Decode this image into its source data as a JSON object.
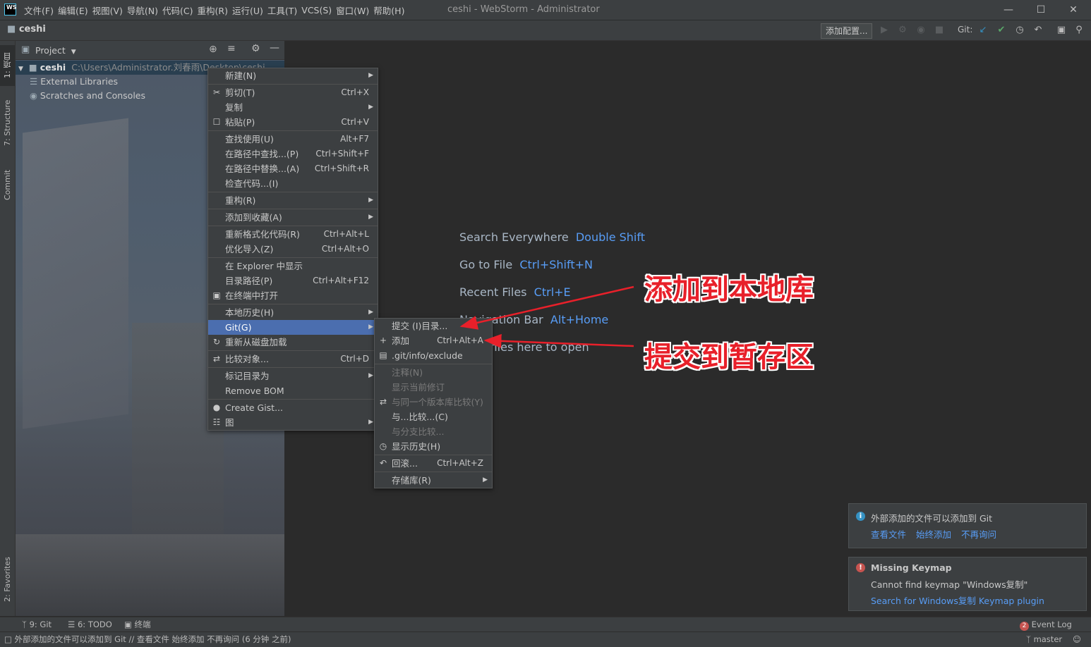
{
  "app": {
    "window_title": "ceshi - WebStorm - Administrator",
    "logo_text": "WS",
    "menubar": [
      "文件(F)",
      "编辑(E)",
      "视图(V)",
      "导航(N)",
      "代码(C)",
      "重构(R)",
      "运行(U)",
      "工具(T)",
      "VCS(S)",
      "窗口(W)",
      "帮助(H)"
    ]
  },
  "navbar": {
    "project": "ceshi",
    "add_config": "添加配置...",
    "git_label": "Git:"
  },
  "left_stripe": {
    "tabs": [
      "1: 项目",
      "7: Structure",
      "Commit",
      "2: Favorites"
    ]
  },
  "project_panel": {
    "title": "Project",
    "tree": [
      {
        "name": "ceshi",
        "path": "C:\\Users\\Administrator.刘春雨\\Desktop\\ceshi",
        "icon": "folder-icon"
      },
      {
        "name": "External Libraries",
        "icon": "library-icon"
      },
      {
        "name": "Scratches and Consoles",
        "icon": "scratch-icon"
      }
    ]
  },
  "editor_hints": [
    {
      "label": "Search Everywhere",
      "key": "Double Shift"
    },
    {
      "label": "Go to File",
      "key": "Ctrl+Shift+N"
    },
    {
      "label": "Recent Files",
      "key": "Ctrl+E"
    },
    {
      "label": "Navigation Bar",
      "key": "Alt+Home"
    },
    {
      "label": "Drop files here to open",
      "key": ""
    }
  ],
  "context_menu": [
    {
      "label": "新建(N)",
      "submenu": true
    },
    {
      "sep": true
    },
    {
      "label": "剪切(T)",
      "shortcut": "Ctrl+X",
      "icon": "scissors-icon"
    },
    {
      "label": "复制",
      "submenu": true
    },
    {
      "label": "粘贴(P)",
      "shortcut": "Ctrl+V",
      "icon": "clipboard-icon"
    },
    {
      "sep": true
    },
    {
      "label": "查找使用(U)",
      "shortcut": "Alt+F7"
    },
    {
      "label": "在路径中查找...(P)",
      "shortcut": "Ctrl+Shift+F"
    },
    {
      "label": "在路径中替换...(A)",
      "shortcut": "Ctrl+Shift+R"
    },
    {
      "label": "检查代码...(I)"
    },
    {
      "sep": true
    },
    {
      "label": "重构(R)",
      "submenu": true
    },
    {
      "sep": true
    },
    {
      "label": "添加到收藏(A)",
      "submenu": true
    },
    {
      "sep": true
    },
    {
      "label": "重新格式化代码(R)",
      "shortcut": "Ctrl+Alt+L"
    },
    {
      "label": "优化导入(Z)",
      "shortcut": "Ctrl+Alt+O"
    },
    {
      "sep": true
    },
    {
      "label": "在 Explorer 中显示"
    },
    {
      "label": "目录路径(P)",
      "shortcut": "Ctrl+Alt+F12"
    },
    {
      "label": "在终端中打开",
      "icon": "terminal-icon"
    },
    {
      "sep": true
    },
    {
      "label": "本地历史(H)",
      "submenu": true
    },
    {
      "label": "Git(G)",
      "submenu": true,
      "selected": true
    },
    {
      "label": "重新从磁盘加载",
      "icon": "reload-icon"
    },
    {
      "sep": true
    },
    {
      "label": "比较对象...",
      "shortcut": "Ctrl+D",
      "icon": "compare-icon"
    },
    {
      "sep": true
    },
    {
      "label": "标记目录为",
      "submenu": true
    },
    {
      "label": "Remove BOM"
    },
    {
      "sep": true
    },
    {
      "label": "Create Gist...",
      "icon": "github-icon"
    },
    {
      "label": "图",
      "submenu": true,
      "icon": "diagram-icon"
    }
  ],
  "git_submenu": [
    {
      "label": "提交 (I)目录...",
      "shortcut": ""
    },
    {
      "label": "添加",
      "shortcut": "Ctrl+Alt+A",
      "icon": "plus-icon"
    },
    {
      "label": ".git/info/exclude",
      "icon": "git-file-icon"
    },
    {
      "sep": true
    },
    {
      "label": "注释(N)",
      "disabled": true
    },
    {
      "label": "显示当前修订",
      "disabled": true
    },
    {
      "label": "与同一个版本库比较(Y)",
      "disabled": true,
      "icon": "compare-icon"
    },
    {
      "label": "与...比较...(C)"
    },
    {
      "label": "与分支比较...",
      "disabled": true
    },
    {
      "label": "显示历史(H)",
      "icon": "history-icon"
    },
    {
      "sep": true
    },
    {
      "label": "回滚...",
      "shortcut": "Ctrl+Alt+Z",
      "icon": "rollback-icon"
    },
    {
      "sep": true
    },
    {
      "label": "存储库(R)",
      "submenu": true
    }
  ],
  "annotations": {
    "a1": "添加到本地库",
    "a2": "提交到暂存区"
  },
  "notifications": [
    {
      "title": "外部添加的文件可以添加到 Git",
      "links": [
        "查看文件",
        "始终添加",
        "不再询问"
      ],
      "icon": "info-icon",
      "color": "#3592c4"
    },
    {
      "title": "Missing Keymap",
      "body": "Cannot find keymap \"Windows复制\"",
      "link": "Search for Windows复制 Keymap plugin",
      "icon": "error-icon",
      "color": "#c75450"
    }
  ],
  "bottom_tools": [
    {
      "label": "9: Git",
      "icon": "git-branch-icon"
    },
    {
      "label": "6: TODO",
      "icon": "list-icon"
    },
    {
      "label": "终端",
      "icon": "terminal-icon"
    }
  ],
  "event_log": {
    "count": "2",
    "label": "Event Log"
  },
  "status": {
    "message": "外部添加的文件可以添加到 Git // 查看文件   始终添加   不再询问 (6 分钟 之前)",
    "branch": "master"
  }
}
